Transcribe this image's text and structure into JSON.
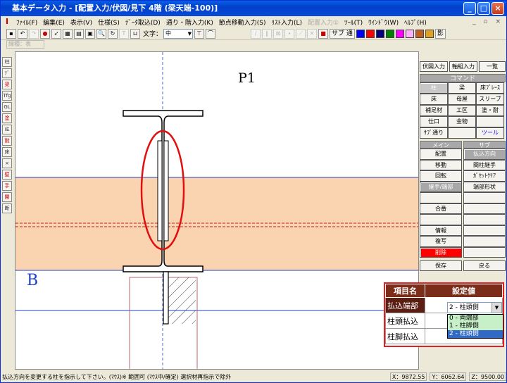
{
  "window": {
    "title": "基本データ入力 - [配置入力/伏図/見下 4階 (梁天端-100)]"
  },
  "menu": [
    {
      "label": "ﾌｧｲﾙ(F)",
      "disabled": false
    },
    {
      "label": "編集(E)",
      "disabled": false
    },
    {
      "label": "表示(V)",
      "disabled": false
    },
    {
      "label": "仕様(S)",
      "disabled": false
    },
    {
      "label": "ﾃﾞｰﾀ取込(D)",
      "disabled": false
    },
    {
      "label": "通り・階入力(K)",
      "disabled": false
    },
    {
      "label": "節点移動入力(S)",
      "disabled": false
    },
    {
      "label": "ﾘｽﾄ入力(L)",
      "disabled": false
    },
    {
      "label": "配置入力①",
      "disabled": true
    },
    {
      "label": "ﾂｰﾙ(T)",
      "disabled": false
    },
    {
      "label": "ｳｲﾝﾄﾞｳ(W)",
      "disabled": false
    },
    {
      "label": "ﾍﾙﾌﾟ(H)",
      "disabled": false
    }
  ],
  "toolbar": {
    "text_label": "文字：",
    "text_size": "中",
    "sub_label": "サブ 通",
    "shadow_label": "影",
    "swatches": [
      "#0000ff",
      "#ff0000",
      "#000080",
      "#008000",
      "#ff00ff",
      "#ffb0ff",
      "#c06020",
      "#e0a020"
    ]
  },
  "toolbar2": {
    "width_select": "線種：表"
  },
  "left_tools": [
    "柱",
    "ﾃﾞ",
    "梁",
    "Tfg",
    "GL",
    "塗",
    "IE",
    "耐",
    "床",
    "×",
    "壁",
    "手",
    "開",
    "断"
  ],
  "canvas": {
    "grid_label_top": "P1",
    "grid_label_b": "B"
  },
  "right_panel": {
    "top_buttons": [
      "伏図入力",
      "軸組入力",
      "一覧"
    ],
    "command_header": "コマンド",
    "commands": [
      "柱",
      "梁",
      "床ﾌﾞﾚｰｽ",
      "床",
      "母屋",
      "スリーブ",
      "補足材",
      "工区",
      "塗・耐",
      "仕口",
      "金物",
      "",
      "ｻﾌﾞ通り",
      "",
      "ツール"
    ],
    "main_header": "メイン",
    "sub_header": "サブ",
    "main_buttons": [
      "配置",
      "移動",
      "回転",
      "継手/端部",
      "",
      "合番",
      "",
      "情報",
      "複写",
      "削除"
    ],
    "sub_buttons": [
      "払込方向",
      "間柱継手",
      "ｶﾞｾｯﾄｸﾘｱ",
      "端部形状",
      "",
      "",
      "",
      "",
      "",
      ""
    ],
    "save_label": "保存",
    "back_label": "戻る"
  },
  "settings": {
    "header_item": "項目名",
    "header_value": "設定値",
    "rows": [
      {
        "name": "払込端部",
        "value": "2 - 柱頭側"
      },
      {
        "name": "柱頭払込",
        "value": ""
      },
      {
        "name": "柱脚払込",
        "value": ""
      }
    ],
    "dropdown_options": [
      "0 - 両端部",
      "1 - 柱脚側",
      "2 - 柱頭側"
    ],
    "dropdown_selected": 2
  },
  "status": {
    "message": "払込方向を変更する柱を指示して下さい。(ﾏｳｽ)※ 範囲可 (ﾏｳｽ中/確定) 選択材再指示で除外",
    "x": "X：9872.55",
    "y": "Y：6062.64",
    "z": "Z：9500.00"
  },
  "colors": {
    "accent_red": "#e02020",
    "band_fill": "#fad3b0",
    "grid_blue": "#1e3fc8"
  }
}
